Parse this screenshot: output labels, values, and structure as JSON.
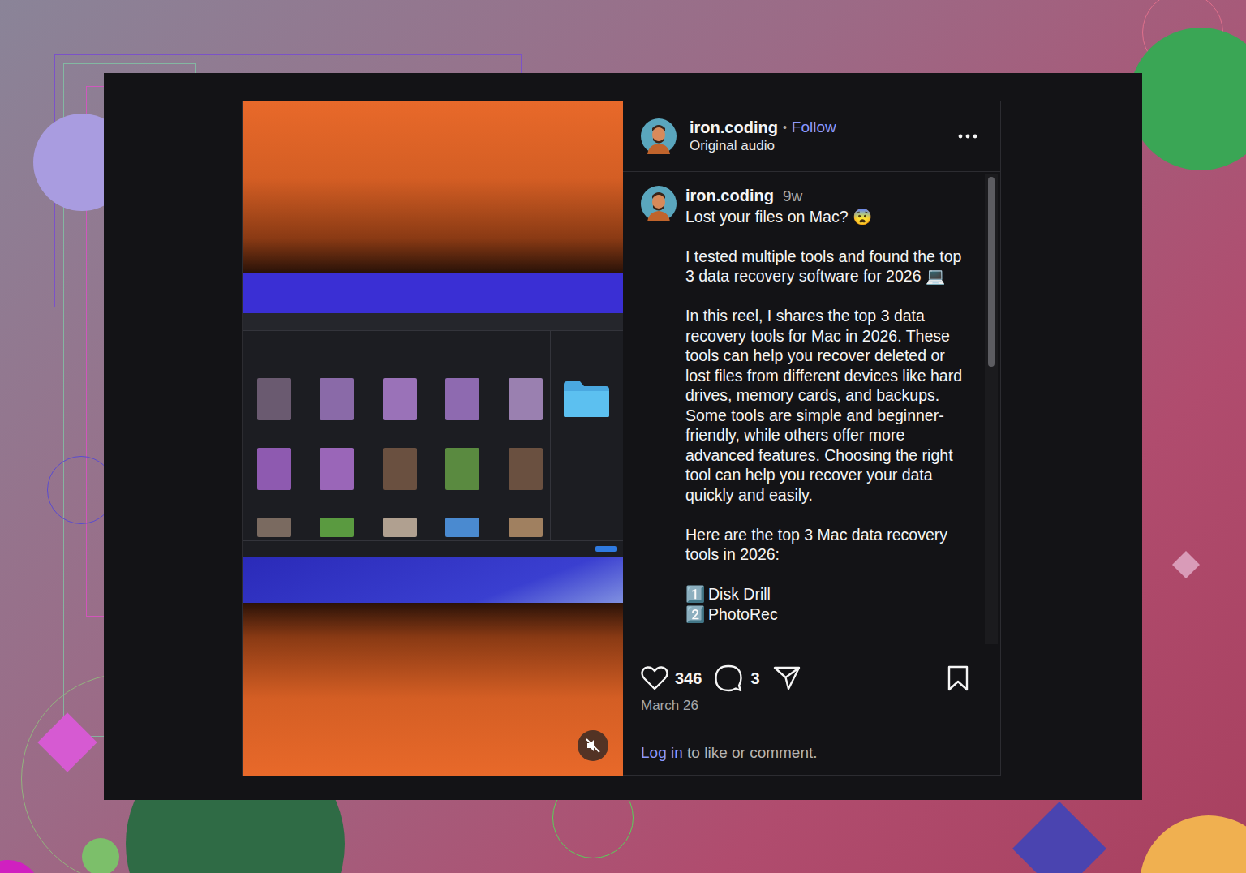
{
  "post": {
    "author": {
      "username": "iron.coding",
      "separator": "•",
      "follow": "Follow",
      "audio": "Original audio"
    },
    "media": {
      "muted": true
    },
    "caption": {
      "username": "iron.coding",
      "age": "9w",
      "paragraphs": [
        "Lost your files on Mac? 😨",
        "I tested multiple tools and found the top 3 data recovery software for 2026 💻",
        "In this reel, I shares the top 3 data recovery tools for Mac in 2026. These tools can help you recover deleted or lost files from different devices like hard drives, memory cards, and backups. Some tools are simple and beginner-friendly, while others offer more advanced features. Choosing the right tool can help you recover your data quickly and easily.",
        "Here are the top 3 Mac data recovery tools in 2026:"
      ],
      "list": [
        {
          "number": "1️⃣",
          "name": "Disk Drill"
        },
        {
          "number": "2️⃣",
          "name": "PhotoRec"
        }
      ]
    },
    "actions": {
      "liked": false,
      "likes": "346",
      "comments": "3",
      "saved": false
    },
    "date": "March 26",
    "login": {
      "link": "Log in",
      "text": " to like or comment."
    }
  }
}
